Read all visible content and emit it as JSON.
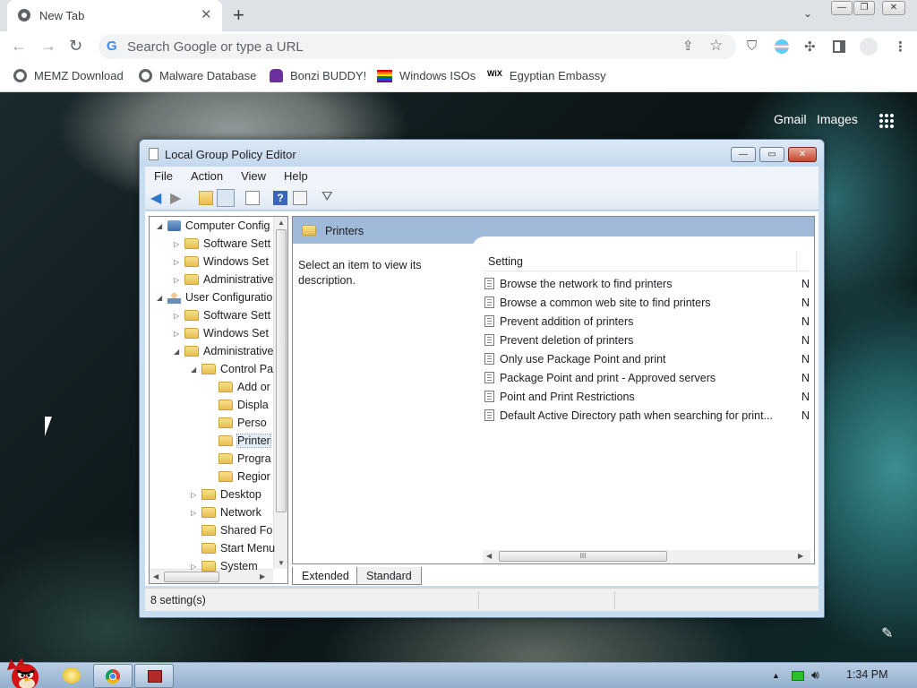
{
  "browser": {
    "tab_title": "New Tab",
    "omnibox_placeholder": "Search Google or type a URL",
    "bookmarks": [
      "MEMZ Download",
      "Malware Database",
      "Bonzi BUDDY!",
      "Windows ISOs",
      "Egyptian Embassy"
    ]
  },
  "google": {
    "gmail": "Gmail",
    "images": "Images"
  },
  "gpedit": {
    "title": "Local Group Policy Editor",
    "menus": [
      "File",
      "Action",
      "View",
      "Help"
    ],
    "tree": [
      {
        "label": "Computer Config",
        "icon": "computer",
        "indent": 0,
        "arrow": "expanded"
      },
      {
        "label": "Software Sett",
        "icon": "folder",
        "indent": 1,
        "arrow": "collapsed"
      },
      {
        "label": "Windows Set",
        "icon": "folder",
        "indent": 1,
        "arrow": "collapsed"
      },
      {
        "label": "Administrative",
        "icon": "folder",
        "indent": 1,
        "arrow": "collapsed"
      },
      {
        "label": "User Configuratio",
        "icon": "user",
        "indent": 0,
        "arrow": "expanded"
      },
      {
        "label": "Software Sett",
        "icon": "folder",
        "indent": 1,
        "arrow": "collapsed"
      },
      {
        "label": "Windows Set",
        "icon": "folder",
        "indent": 1,
        "arrow": "collapsed"
      },
      {
        "label": "Administrative",
        "icon": "folder",
        "indent": 1,
        "arrow": "expanded"
      },
      {
        "label": "Control Pa",
        "icon": "folder",
        "indent": 2,
        "arrow": "expanded"
      },
      {
        "label": "Add or",
        "icon": "folder",
        "indent": 3,
        "arrow": "none"
      },
      {
        "label": "Displa",
        "icon": "folder",
        "indent": 3,
        "arrow": "none"
      },
      {
        "label": "Perso",
        "icon": "folder",
        "indent": 3,
        "arrow": "none"
      },
      {
        "label": "Printer",
        "icon": "folder",
        "indent": 3,
        "arrow": "none",
        "selected": true
      },
      {
        "label": "Progra",
        "icon": "folder",
        "indent": 3,
        "arrow": "none"
      },
      {
        "label": "Regior",
        "icon": "folder",
        "indent": 3,
        "arrow": "none"
      },
      {
        "label": "Desktop",
        "icon": "folder",
        "indent": 2,
        "arrow": "collapsed"
      },
      {
        "label": "Network",
        "icon": "folder",
        "indent": 2,
        "arrow": "collapsed"
      },
      {
        "label": "Shared Fo",
        "icon": "folder",
        "indent": 2,
        "arrow": "none"
      },
      {
        "label": "Start Menu",
        "icon": "folder",
        "indent": 2,
        "arrow": "none"
      },
      {
        "label": "System",
        "icon": "folder",
        "indent": 2,
        "arrow": "collapsed"
      }
    ],
    "panel_header": "Printers",
    "description": "Select an item to view its description.",
    "column_setting": "Setting",
    "settings": [
      {
        "name": "Browse the network to find printers",
        "state": "N"
      },
      {
        "name": "Browse a common web site to find printers",
        "state": "N"
      },
      {
        "name": "Prevent addition of printers",
        "state": "N"
      },
      {
        "name": "Prevent deletion of printers",
        "state": "N"
      },
      {
        "name": "Only use Package Point and print",
        "state": "N"
      },
      {
        "name": "Package Point and print - Approved servers",
        "state": "N"
      },
      {
        "name": "Point and Print Restrictions",
        "state": "N"
      },
      {
        "name": "Default Active Directory path when searching for print...",
        "state": "N"
      }
    ],
    "view_tabs": [
      "Extended",
      "Standard"
    ],
    "status": "8 setting(s)"
  },
  "taskbar": {
    "clock": "1:34 PM"
  }
}
